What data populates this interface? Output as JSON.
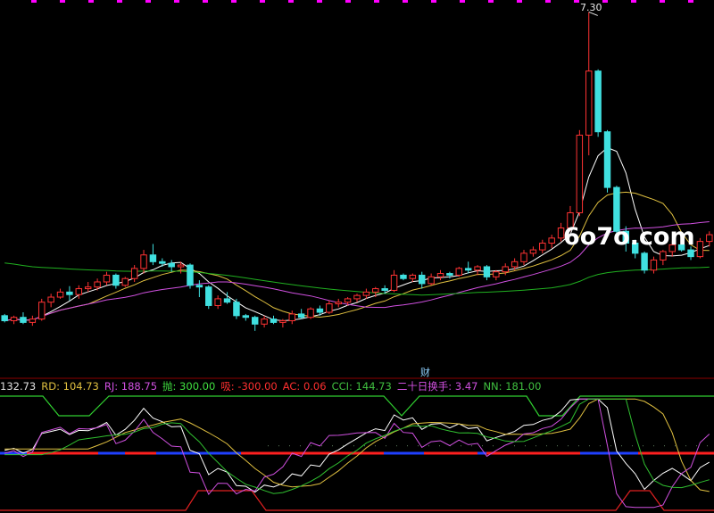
{
  "watermark": "6o7o.com",
  "marker_label": "财",
  "high_label": "7.30",
  "indicators": [
    {
      "text": "132.73",
      "color": "#e0e0e0"
    },
    {
      "text": "RD: 104.73",
      "color": "#e0c040"
    },
    {
      "text": "RJ: 188.75",
      "color": "#d050e0"
    },
    {
      "text": "抛: 300.00",
      "color": "#40e040"
    },
    {
      "text": "吸: -300.00",
      "color": "#ff3030"
    },
    {
      "text": "AC: 0.06",
      "color": "#ff3030"
    },
    {
      "text": "CCI: 144.73",
      "color": "#40c040"
    },
    {
      "text": "二十日换手: 3.47",
      "color": "#d050e0"
    },
    {
      "text": "NN: 181.00",
      "color": "#40c040"
    }
  ],
  "colors": {
    "up": "#ff3333",
    "down": "#40e0e0",
    "ma5": "#ffffff",
    "ma10": "#e0c040",
    "ma20": "#d050e0",
    "ma60": "#20b020",
    "grid": "#8b0000",
    "magenta": "#ff00ff"
  },
  "chart_data": [
    {
      "type": "candlestick",
      "candles": [
        [
          3.7,
          3.72,
          3.62,
          3.64
        ],
        [
          3.64,
          3.7,
          3.6,
          3.68
        ],
        [
          3.68,
          3.74,
          3.6,
          3.62
        ],
        [
          3.62,
          3.7,
          3.58,
          3.66
        ],
        [
          3.66,
          3.9,
          3.64,
          3.86
        ],
        [
          3.86,
          3.96,
          3.8,
          3.92
        ],
        [
          3.92,
          4.02,
          3.9,
          3.98
        ],
        [
          3.98,
          4.05,
          3.88,
          3.95
        ],
        [
          3.95,
          4.06,
          3.9,
          4.02
        ],
        [
          4.02,
          4.1,
          3.98,
          4.04
        ],
        [
          4.04,
          4.14,
          4.0,
          4.1
        ],
        [
          4.1,
          4.22,
          4.06,
          4.18
        ],
        [
          4.18,
          4.2,
          4.02,
          4.06
        ],
        [
          4.06,
          4.16,
          4.04,
          4.14
        ],
        [
          4.14,
          4.3,
          4.1,
          4.26
        ],
        [
          4.26,
          4.48,
          4.2,
          4.42
        ],
        [
          4.42,
          4.55,
          4.3,
          4.34
        ],
        [
          4.34,
          4.38,
          4.28,
          4.32
        ],
        [
          4.32,
          4.36,
          4.22,
          4.28
        ],
        [
          4.28,
          4.34,
          4.2,
          4.3
        ],
        [
          4.3,
          4.32,
          4.02,
          4.06
        ],
        [
          4.06,
          4.12,
          3.92,
          4.04
        ],
        [
          4.04,
          4.06,
          3.78,
          3.82
        ],
        [
          3.82,
          3.94,
          3.78,
          3.9
        ],
        [
          3.9,
          3.98,
          3.84,
          3.86
        ],
        [
          3.86,
          3.9,
          3.66,
          3.7
        ],
        [
          3.7,
          3.72,
          3.64,
          3.68
        ],
        [
          3.68,
          3.7,
          3.52,
          3.6
        ],
        [
          3.6,
          3.7,
          3.56,
          3.66
        ],
        [
          3.66,
          3.7,
          3.6,
          3.62
        ],
        [
          3.62,
          3.66,
          3.56,
          3.64
        ],
        [
          3.64,
          3.76,
          3.6,
          3.72
        ],
        [
          3.72,
          3.78,
          3.66,
          3.68
        ],
        [
          3.68,
          3.8,
          3.66,
          3.78
        ],
        [
          3.78,
          3.82,
          3.7,
          3.74
        ],
        [
          3.74,
          3.88,
          3.72,
          3.84
        ],
        [
          3.84,
          3.9,
          3.8,
          3.86
        ],
        [
          3.86,
          3.92,
          3.82,
          3.9
        ],
        [
          3.9,
          3.96,
          3.86,
          3.94
        ],
        [
          3.94,
          4.02,
          3.9,
          3.98
        ],
        [
          3.98,
          4.04,
          3.92,
          4.02
        ],
        [
          4.02,
          4.06,
          3.96,
          4.0
        ],
        [
          4.0,
          4.24,
          3.98,
          4.18
        ],
        [
          4.18,
          4.2,
          4.12,
          4.14
        ],
        [
          4.14,
          4.2,
          4.1,
          4.18
        ],
        [
          4.18,
          4.22,
          4.02,
          4.08
        ],
        [
          4.08,
          4.2,
          4.06,
          4.16
        ],
        [
          4.16,
          4.24,
          4.12,
          4.2
        ],
        [
          4.2,
          4.22,
          4.14,
          4.18
        ],
        [
          4.18,
          4.28,
          4.16,
          4.26
        ],
        [
          4.26,
          4.34,
          4.2,
          4.24
        ],
        [
          4.24,
          4.3,
          4.18,
          4.28
        ],
        [
          4.28,
          4.3,
          4.12,
          4.16
        ],
        [
          4.16,
          4.24,
          4.12,
          4.22
        ],
        [
          4.22,
          4.32,
          4.18,
          4.28
        ],
        [
          4.28,
          4.38,
          4.24,
          4.34
        ],
        [
          4.34,
          4.48,
          4.3,
          4.44
        ],
        [
          4.44,
          4.52,
          4.4,
          4.48
        ],
        [
          4.48,
          4.6,
          4.44,
          4.56
        ],
        [
          4.56,
          4.66,
          4.5,
          4.62
        ],
        [
          4.62,
          4.8,
          4.58,
          4.74
        ],
        [
          4.74,
          5.0,
          4.7,
          4.92
        ],
        [
          4.92,
          5.9,
          4.88,
          5.84
        ],
        [
          5.84,
          7.3,
          5.6,
          6.6
        ],
        [
          6.6,
          6.62,
          5.82,
          5.88
        ],
        [
          5.88,
          5.9,
          5.16,
          5.22
        ],
        [
          5.22,
          5.24,
          4.66,
          4.7
        ],
        [
          4.7,
          4.76,
          4.46,
          4.56
        ],
        [
          4.56,
          4.6,
          4.38,
          4.44
        ],
        [
          4.44,
          4.46,
          4.2,
          4.24
        ],
        [
          4.24,
          4.4,
          4.2,
          4.36
        ],
        [
          4.36,
          4.48,
          4.3,
          4.46
        ],
        [
          4.46,
          4.58,
          4.4,
          4.54
        ],
        [
          4.54,
          4.62,
          4.46,
          4.48
        ],
        [
          4.48,
          4.52,
          4.36,
          4.4
        ],
        [
          4.4,
          4.62,
          4.38,
          4.58
        ],
        [
          4.58,
          4.7,
          4.52,
          4.66
        ]
      ],
      "ma_periods": [
        5,
        10,
        20,
        60
      ],
      "y_range": [
        3.0,
        7.4
      ]
    },
    {
      "type": "line",
      "title": "",
      "y_range": [
        -400,
        400
      ]
    }
  ]
}
